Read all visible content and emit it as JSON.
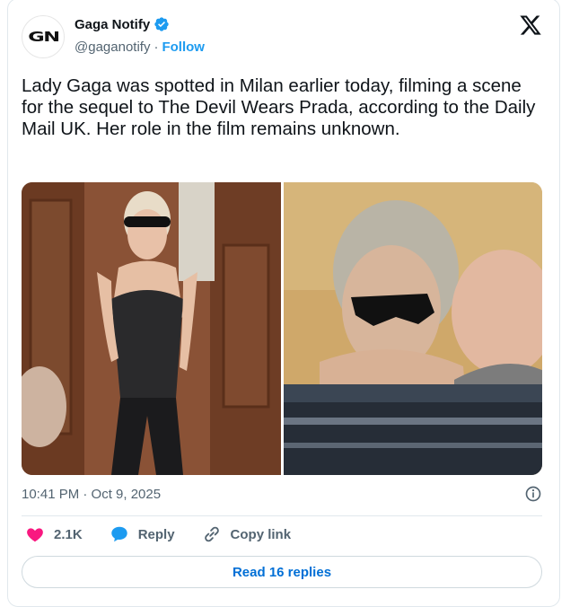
{
  "author": {
    "name": "Gaga Notify",
    "handle": "@gaganotify",
    "separator": "·",
    "follow_label": "Follow",
    "avatar_text": "GN",
    "verified": true
  },
  "tweet": {
    "text": "Lady Gaga was spotted in Milan earlier today, filming a scene for the sequel to The Devil Wears Prada, according to the Daily Mail UK. Her role in the film remains unknown.",
    "timestamp": "10:41 PM · Oct 9, 2025"
  },
  "actions": {
    "like_count": "2.1K",
    "reply_label": "Reply",
    "copy_link_label": "Copy link"
  },
  "read_replies_label": "Read 16 replies",
  "colors": {
    "accent": "#1d9bf0",
    "like": "#f91880",
    "secondary_text": "#536471"
  }
}
